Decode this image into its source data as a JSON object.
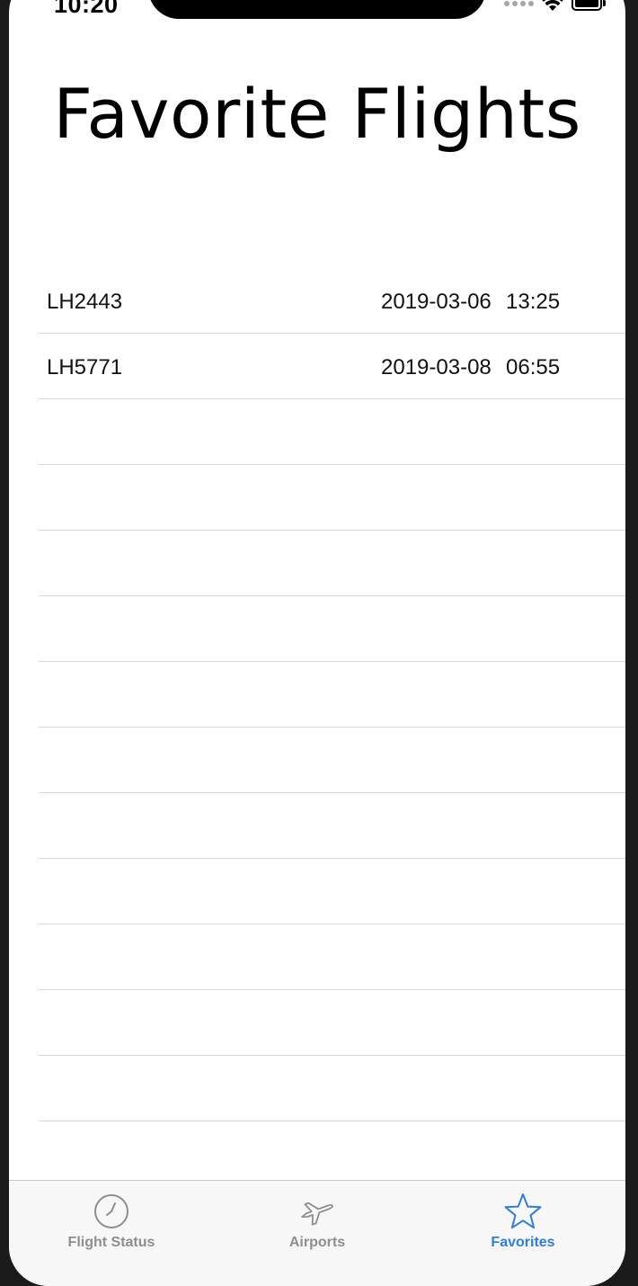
{
  "status_bar": {
    "time": "10:20"
  },
  "page": {
    "title": "Favorite Flights"
  },
  "favorites": [
    {
      "flight": "LH2443",
      "date": "2019-03-06",
      "time": "13:25"
    },
    {
      "flight": "LH5771",
      "date": "2019-03-08",
      "time": "06:55"
    }
  ],
  "tabbar": {
    "tabs": [
      {
        "label": "Flight Status",
        "icon": "clock-icon",
        "active": false
      },
      {
        "label": "Airports",
        "icon": "airplane-icon",
        "active": false
      },
      {
        "label": "Favorites",
        "icon": "star-icon",
        "active": true
      }
    ]
  },
  "colors": {
    "accent": "#2f7de1",
    "inactive": "#8e8e8e",
    "separator": "#d8d8d8"
  }
}
